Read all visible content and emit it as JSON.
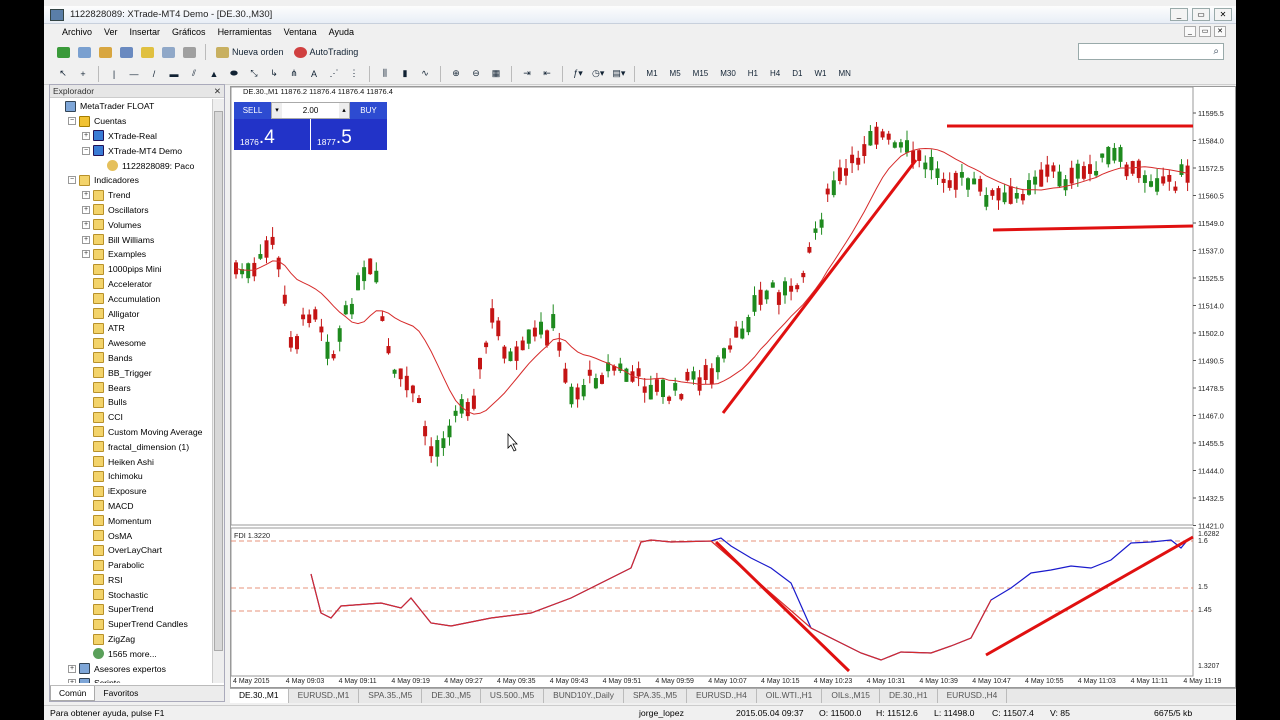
{
  "window": {
    "title": "1122828089: XTrade-MT4 Demo - [DE.30.,M30]"
  },
  "menu": [
    "Archivo",
    "Ver",
    "Insertar",
    "Gráficos",
    "Herramientas",
    "Ventana",
    "Ayuda"
  ],
  "toolbar": {
    "new_order": "Nueva orden",
    "autotrading": "AutoTrading",
    "timeframes": [
      "M1",
      "M5",
      "M15",
      "M30",
      "H1",
      "H4",
      "D1",
      "W1",
      "MN"
    ]
  },
  "explorer": {
    "title": "Explorador",
    "items": [
      {
        "label": "MetaTrader FLOAT",
        "level": 0,
        "icon": "root",
        "exp": ""
      },
      {
        "label": "Cuentas",
        "level": 1,
        "icon": "folder",
        "exp": "−"
      },
      {
        "label": "XTrade-Real",
        "level": 2,
        "icon": "acc",
        "exp": "+"
      },
      {
        "label": "XTrade-MT4 Demo",
        "level": 2,
        "icon": "acc",
        "exp": "−"
      },
      {
        "label": "1122828089: Paco",
        "level": 3,
        "icon": "user",
        "exp": ""
      },
      {
        "label": "Indicadores",
        "level": 1,
        "icon": "ind",
        "exp": "−"
      },
      {
        "label": "Trend",
        "level": 2,
        "icon": "ind",
        "exp": "+"
      },
      {
        "label": "Oscillators",
        "level": 2,
        "icon": "ind",
        "exp": "+"
      },
      {
        "label": "Volumes",
        "level": 2,
        "icon": "ind",
        "exp": "+"
      },
      {
        "label": "Bill Williams",
        "level": 2,
        "icon": "ind",
        "exp": "+"
      },
      {
        "label": "Examples",
        "level": 2,
        "icon": "ind",
        "exp": "+"
      },
      {
        "label": "1000pips Mini",
        "level": 2,
        "icon": "ind",
        "exp": ""
      },
      {
        "label": "Accelerator",
        "level": 2,
        "icon": "ind",
        "exp": ""
      },
      {
        "label": "Accumulation",
        "level": 2,
        "icon": "ind",
        "exp": ""
      },
      {
        "label": "Alligator",
        "level": 2,
        "icon": "ind",
        "exp": ""
      },
      {
        "label": "ATR",
        "level": 2,
        "icon": "ind",
        "exp": ""
      },
      {
        "label": "Awesome",
        "level": 2,
        "icon": "ind",
        "exp": ""
      },
      {
        "label": "Bands",
        "level": 2,
        "icon": "ind",
        "exp": ""
      },
      {
        "label": "BB_Trigger",
        "level": 2,
        "icon": "ind",
        "exp": ""
      },
      {
        "label": "Bears",
        "level": 2,
        "icon": "ind",
        "exp": ""
      },
      {
        "label": "Bulls",
        "level": 2,
        "icon": "ind",
        "exp": ""
      },
      {
        "label": "CCI",
        "level": 2,
        "icon": "ind",
        "exp": ""
      },
      {
        "label": "Custom Moving Average",
        "level": 2,
        "icon": "ind",
        "exp": ""
      },
      {
        "label": "fractal_dimension (1)",
        "level": 2,
        "icon": "ind",
        "exp": ""
      },
      {
        "label": "Heiken Ashi",
        "level": 2,
        "icon": "ind",
        "exp": ""
      },
      {
        "label": "Ichimoku",
        "level": 2,
        "icon": "ind",
        "exp": ""
      },
      {
        "label": "iExposure",
        "level": 2,
        "icon": "ind",
        "exp": ""
      },
      {
        "label": "MACD",
        "level": 2,
        "icon": "ind",
        "exp": ""
      },
      {
        "label": "Momentum",
        "level": 2,
        "icon": "ind",
        "exp": ""
      },
      {
        "label": "OsMA",
        "level": 2,
        "icon": "ind",
        "exp": ""
      },
      {
        "label": "OverLayChart",
        "level": 2,
        "icon": "ind",
        "exp": ""
      },
      {
        "label": "Parabolic",
        "level": 2,
        "icon": "ind",
        "exp": ""
      },
      {
        "label": "RSI",
        "level": 2,
        "icon": "ind",
        "exp": ""
      },
      {
        "label": "Stochastic",
        "level": 2,
        "icon": "ind",
        "exp": ""
      },
      {
        "label": "SuperTrend",
        "level": 2,
        "icon": "ind",
        "exp": ""
      },
      {
        "label": "SuperTrend Candles",
        "level": 2,
        "icon": "ind",
        "exp": ""
      },
      {
        "label": "ZigZag",
        "level": 2,
        "icon": "ind",
        "exp": ""
      },
      {
        "label": "1565 more...",
        "level": 2,
        "icon": "more",
        "exp": ""
      },
      {
        "label": "Asesores expertos",
        "level": 1,
        "icon": "root",
        "exp": "+"
      },
      {
        "label": "Scripts",
        "level": 1,
        "icon": "root",
        "exp": "+"
      }
    ],
    "tabs": [
      "Común",
      "Favoritos"
    ]
  },
  "chart": {
    "quote_line": "DE.30.,M1  11876.2 11876.4 11876.4 11876.4",
    "lot": "2.00",
    "sell_label": "SELL",
    "buy_label": "BUY",
    "sell_small": "1876",
    "sell_big": ".4",
    "buy_small": "1877",
    "buy_big": ".5",
    "indicator_label": "FDI 1.3220",
    "price_ticks": [
      "11595.5",
      "11584.0",
      "11572.5",
      "11560.5",
      "11549.0",
      "11537.0",
      "11525.5",
      "11514.0",
      "11502.0",
      "11490.5",
      "11478.5",
      "11467.0",
      "11455.5",
      "11444.0",
      "11432.5",
      "11421.0"
    ],
    "ind_ticks": [
      "1.6282",
      "1.6",
      "1.5",
      "1.45",
      "1.3207"
    ],
    "time_ticks": [
      "4 May 2015",
      "4 May 09:03",
      "4 May 09:11",
      "4 May 09:19",
      "4 May 09:27",
      "4 May 09:35",
      "4 May 09:43",
      "4 May 09:51",
      "4 May 09:59",
      "4 May 10:07",
      "4 May 10:15",
      "4 May 10:23",
      "4 May 10:31",
      "4 May 10:39",
      "4 May 10:47",
      "4 May 10:55",
      "4 May 11:03",
      "4 May 11:11",
      "4 May 11:19"
    ],
    "colors": {
      "bull": "#1e8a1e",
      "bear": "#c41414",
      "ma": "#d62b2b",
      "fdi": "#1a1acc",
      "draw": "#e01010"
    }
  },
  "chart_tabs": [
    "DE.30.,M1",
    "EURUSD.,M1",
    "SPA.35.,M5",
    "DE.30.,M5",
    "US.500.,M5",
    "BUND10Y.,Daily",
    "SPA.35.,M5",
    "EURUSD.,H4",
    "OIL.WTI.,H1",
    "OILs.,M15",
    "DE.30.,H1",
    "EURUSD.,H4"
  ],
  "status": {
    "help": "Para obtener ayuda, pulse F1",
    "profile": "jorge_lopez",
    "datetime": "2015.05.04 09:37",
    "open": "O: 11500.0",
    "high": "H: 11512.6",
    "close_low": "L: 11498.0",
    "close": "C: 11507.4",
    "volume": "V: 85",
    "traffic": "6675/5 kb"
  }
}
